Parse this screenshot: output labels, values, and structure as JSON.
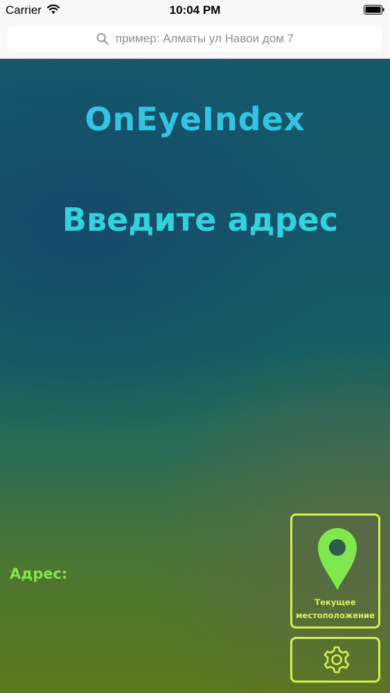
{
  "status_bar": {
    "carrier": "Carrier",
    "time": "10:04 PM",
    "wifi_icon": "wifi-icon",
    "battery_icon": "battery-icon"
  },
  "search": {
    "placeholder": "пример: Алматы ул Навои дом 7",
    "icon": "search-icon"
  },
  "main": {
    "title": "OnEyeIndex",
    "prompt": "Введите адрес",
    "address_label": "Адрес:",
    "location_button": {
      "icon": "map-pin-icon",
      "label_line1": "Текущее",
      "label_line2": "местоположение"
    },
    "settings_button": {
      "icon": "gear-icon"
    }
  },
  "colors": {
    "title": "#33c4e4",
    "prompt": "#32d1dd",
    "address_label": "#83e64c",
    "button_border": "#d4f04d",
    "pin": "#7ee84c"
  }
}
